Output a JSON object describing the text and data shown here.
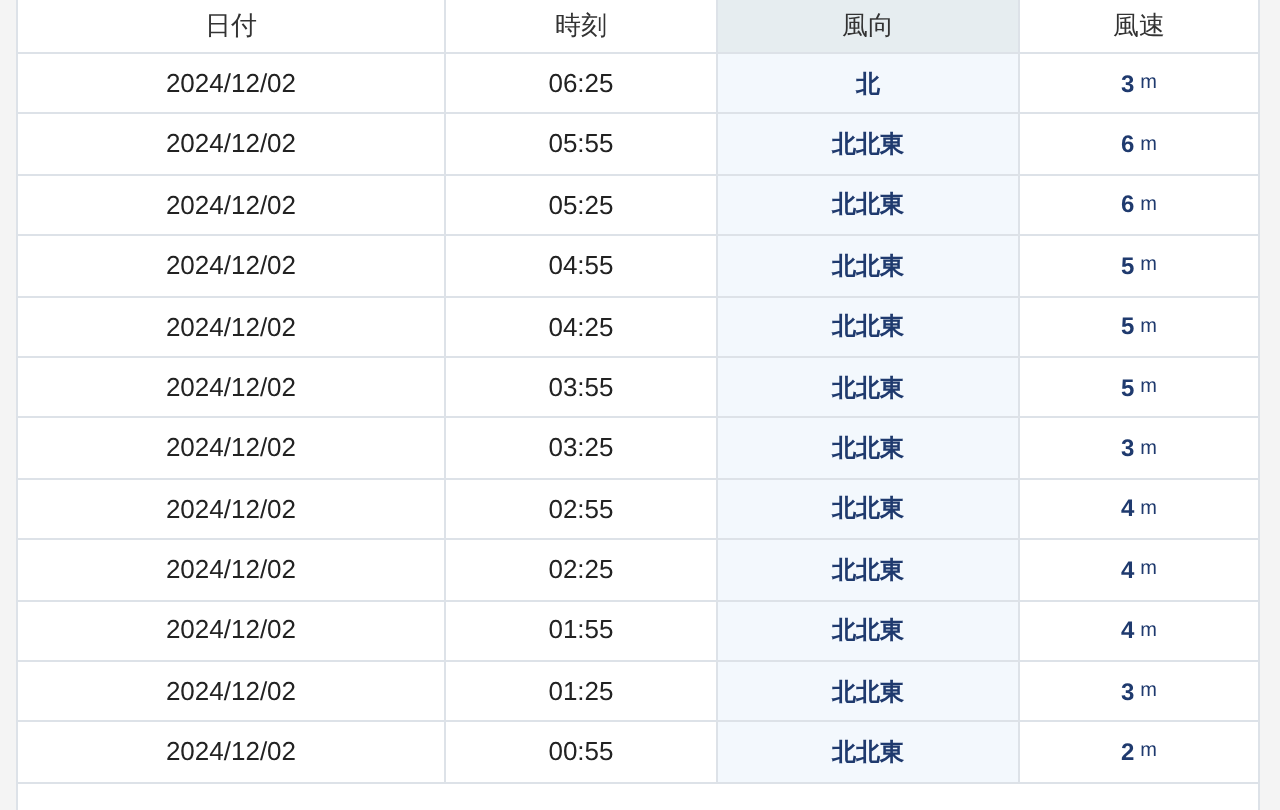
{
  "table": {
    "columns": [
      {
        "label": "日付",
        "highlighted": false
      },
      {
        "label": "時刻",
        "highlighted": false
      },
      {
        "label": "風向",
        "highlighted": true
      },
      {
        "label": "風速",
        "highlighted": false
      }
    ],
    "rows": [
      {
        "date": "2024/12/02",
        "time": "06:25",
        "direction": "北",
        "speed": "3",
        "unit": "m"
      },
      {
        "date": "2024/12/02",
        "time": "05:55",
        "direction": "北北東",
        "speed": "6",
        "unit": "m"
      },
      {
        "date": "2024/12/02",
        "time": "05:25",
        "direction": "北北東",
        "speed": "6",
        "unit": "m"
      },
      {
        "date": "2024/12/02",
        "time": "04:55",
        "direction": "北北東",
        "speed": "5",
        "unit": "m"
      },
      {
        "date": "2024/12/02",
        "time": "04:25",
        "direction": "北北東",
        "speed": "5",
        "unit": "m"
      },
      {
        "date": "2024/12/02",
        "time": "03:55",
        "direction": "北北東",
        "speed": "5",
        "unit": "m"
      },
      {
        "date": "2024/12/02",
        "time": "03:25",
        "direction": "北北東",
        "speed": "3",
        "unit": "m"
      },
      {
        "date": "2024/12/02",
        "time": "02:55",
        "direction": "北北東",
        "speed": "4",
        "unit": "m"
      },
      {
        "date": "2024/12/02",
        "time": "02:25",
        "direction": "北北東",
        "speed": "4",
        "unit": "m"
      },
      {
        "date": "2024/12/02",
        "time": "01:55",
        "direction": "北北東",
        "speed": "4",
        "unit": "m"
      },
      {
        "date": "2024/12/02",
        "time": "01:25",
        "direction": "北北東",
        "speed": "3",
        "unit": "m"
      },
      {
        "date": "2024/12/02",
        "time": "00:55",
        "direction": "北北東",
        "speed": "2",
        "unit": "m"
      }
    ]
  }
}
